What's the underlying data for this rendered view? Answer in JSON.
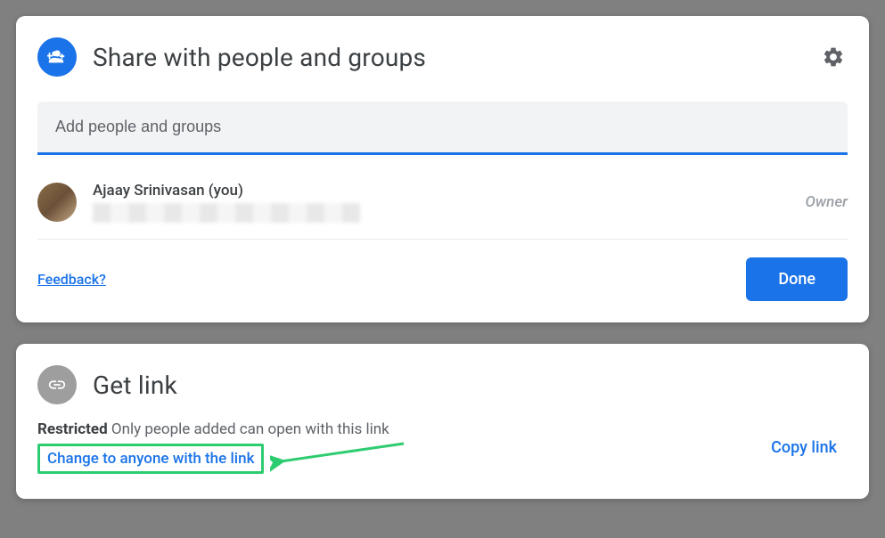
{
  "share": {
    "title": "Share with people and groups",
    "input_placeholder": "Add people and groups",
    "person": {
      "name": "Ajaay Srinivasan (you)",
      "role": "Owner"
    },
    "feedback": "Feedback?",
    "done": "Done"
  },
  "getlink": {
    "title": "Get link",
    "restricted_label": "Restricted",
    "restricted_desc": " Only people added can open with this link",
    "change": "Change to anyone with the link",
    "copy": "Copy link"
  }
}
